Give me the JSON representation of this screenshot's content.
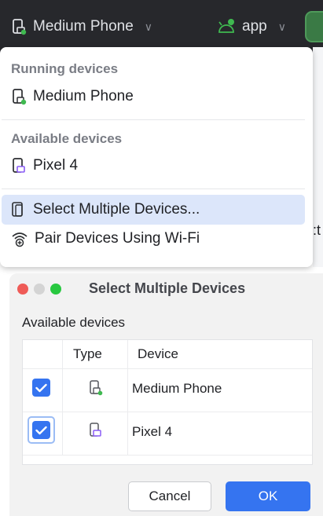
{
  "toolbar": {
    "device_label": "Medium Phone",
    "app_label": "app"
  },
  "dropdown": {
    "running_header": "Running devices",
    "running_devices": [
      "Medium Phone"
    ],
    "available_header": "Available devices",
    "available_devices": [
      "Pixel 4"
    ],
    "select_multiple_label": "Select Multiple Devices...",
    "pair_wifi_label": "Pair Devices Using Wi-Fi"
  },
  "background_fragment": ":t",
  "dialog": {
    "title": "Select Multiple Devices",
    "section_label": "Available devices",
    "columns": [
      "Type",
      "Device"
    ],
    "rows": [
      {
        "device": "Medium Phone",
        "checked": true,
        "running": true
      },
      {
        "device": "Pixel 4",
        "checked": true,
        "running": false
      }
    ],
    "cancel_label": "Cancel",
    "ok_label": "OK"
  },
  "colors": {
    "accent": "#3574f0",
    "running_indicator": "#3fb950",
    "device_icon_accent": "#8a5cf5"
  }
}
